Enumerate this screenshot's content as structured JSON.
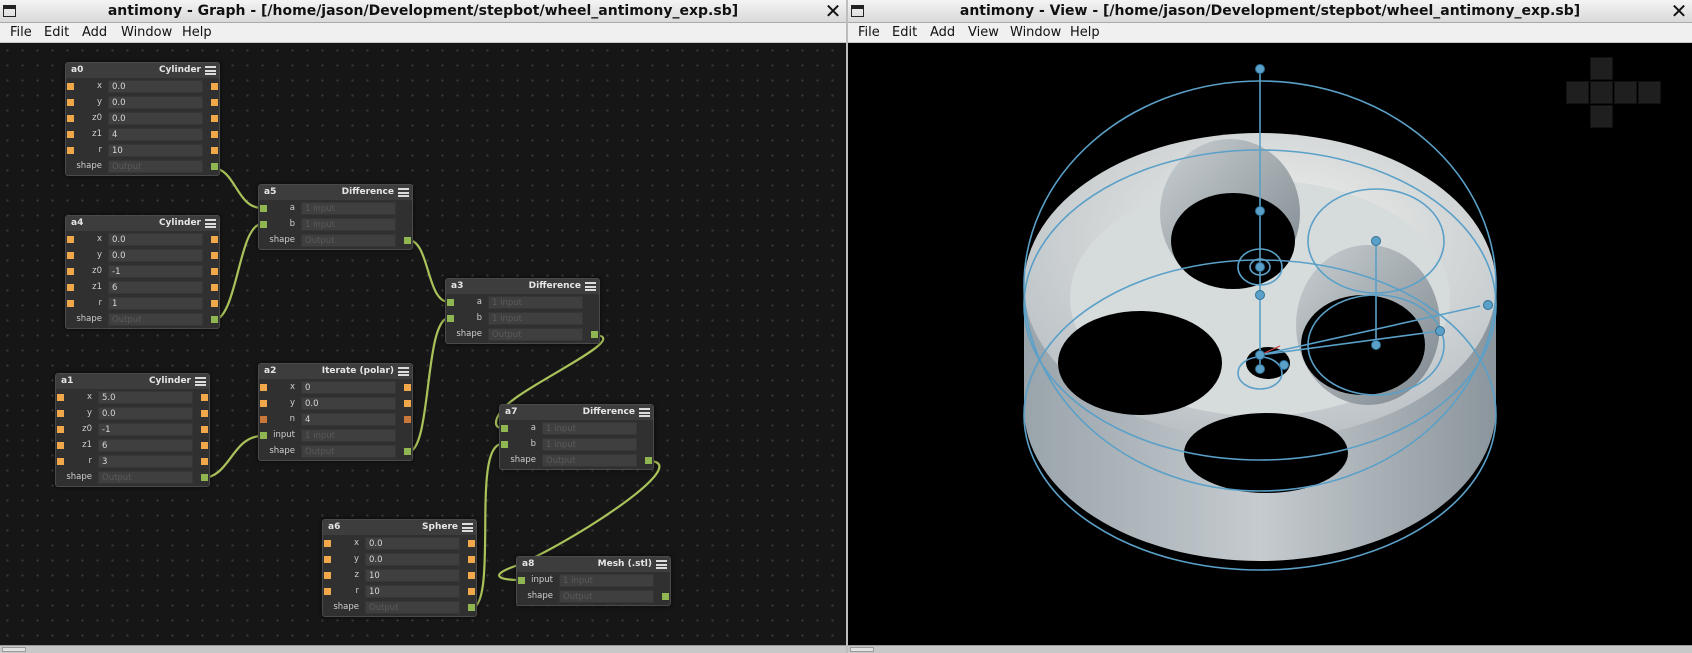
{
  "graph_window": {
    "title": "antimony - Graph - [/home/jason/Development/stepbot/wheel_antimony_exp.sb]",
    "menu": [
      "File",
      "Edit",
      "Add",
      "Window",
      "Help"
    ]
  },
  "view_window": {
    "title": "antimony - View - [/home/jason/Development/stepbot/wheel_antimony_exp.sb]",
    "menu": [
      "File",
      "Edit",
      "Add",
      "View",
      "Window",
      "Help"
    ]
  },
  "nodes": {
    "a0": {
      "id": "a0",
      "type": "Cylinder",
      "rows": [
        {
          "label": "x",
          "value": "0.0"
        },
        {
          "label": "y",
          "value": "0.0"
        },
        {
          "label": "z0",
          "value": "0.0"
        },
        {
          "label": "z1",
          "value": "4"
        },
        {
          "label": "r",
          "value": "10"
        },
        {
          "label": "shape",
          "value": "Output"
        }
      ]
    },
    "a4": {
      "id": "a4",
      "type": "Cylinder",
      "rows": [
        {
          "label": "x",
          "value": "0.0"
        },
        {
          "label": "y",
          "value": "0.0"
        },
        {
          "label": "z0",
          "value": "-1"
        },
        {
          "label": "z1",
          "value": "6"
        },
        {
          "label": "r",
          "value": "1"
        },
        {
          "label": "shape",
          "value": "Output"
        }
      ]
    },
    "a1": {
      "id": "a1",
      "type": "Cylinder",
      "rows": [
        {
          "label": "x",
          "value": "5.0"
        },
        {
          "label": "y",
          "value": "0.0"
        },
        {
          "label": "z0",
          "value": "-1"
        },
        {
          "label": "z1",
          "value": "6"
        },
        {
          "label": "r",
          "value": "3"
        },
        {
          "label": "shape",
          "value": "Output"
        }
      ]
    },
    "a5": {
      "id": "a5",
      "type": "Difference",
      "rows": [
        {
          "label": "a",
          "value": "1 input"
        },
        {
          "label": "b",
          "value": "1 input"
        },
        {
          "label": "shape",
          "value": "Output"
        }
      ]
    },
    "a2": {
      "id": "a2",
      "type": "Iterate (polar)",
      "rows": [
        {
          "label": "x",
          "value": "0"
        },
        {
          "label": "y",
          "value": "0.0"
        },
        {
          "label": "n",
          "value": "4"
        },
        {
          "label": "input",
          "value": "1 input"
        },
        {
          "label": "shape",
          "value": "Output"
        }
      ]
    },
    "a3": {
      "id": "a3",
      "type": "Difference",
      "rows": [
        {
          "label": "a",
          "value": "1 input"
        },
        {
          "label": "b",
          "value": "1 input"
        },
        {
          "label": "shape",
          "value": "Output"
        }
      ]
    },
    "a7": {
      "id": "a7",
      "type": "Difference",
      "rows": [
        {
          "label": "a",
          "value": "1 input"
        },
        {
          "label": "b",
          "value": "1 input"
        },
        {
          "label": "shape",
          "value": "Output"
        }
      ]
    },
    "a6": {
      "id": "a6",
      "type": "Sphere",
      "rows": [
        {
          "label": "x",
          "value": "0.0"
        },
        {
          "label": "y",
          "value": "0.0"
        },
        {
          "label": "z",
          "value": "10"
        },
        {
          "label": "r",
          "value": "10"
        },
        {
          "label": "shape",
          "value": "Output"
        }
      ]
    },
    "a8": {
      "id": "a8",
      "type": "Mesh (.stl)",
      "rows": [
        {
          "label": "input",
          "value": "1 input"
        },
        {
          "label": "shape",
          "value": "Output"
        }
      ]
    }
  },
  "colors": {
    "wire": "#a9c25a",
    "port": "#f0a84a",
    "port_out": "#8fb650",
    "outline": "#5aa0c8"
  },
  "icons": [
    "close-icon",
    "window-menu-icon",
    "node-menu-icon",
    "nav-cube-icon"
  ]
}
